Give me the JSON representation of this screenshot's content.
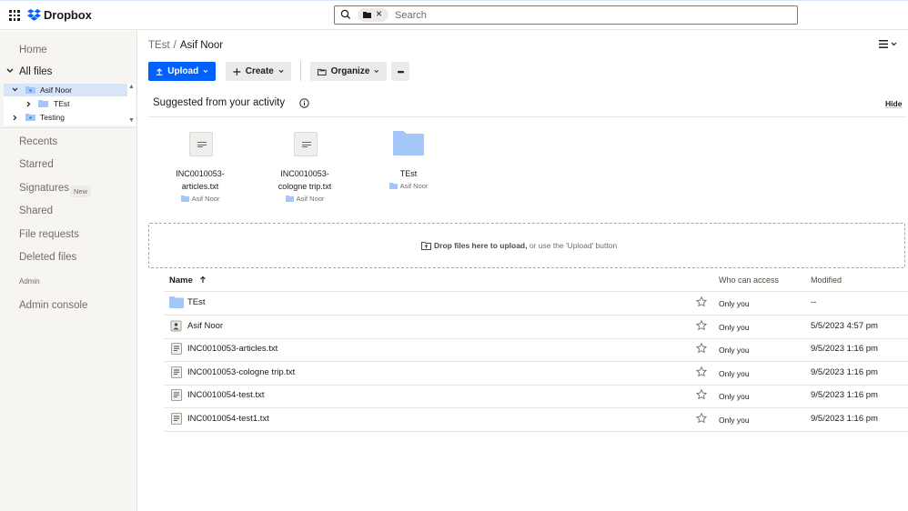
{
  "app": {
    "name": "Dropbox"
  },
  "colors": {
    "accent": "#0061fe",
    "folder": "#a3c8f7",
    "sidebar_bg": "#f7f5f2"
  },
  "search": {
    "placeholder": "Search"
  },
  "sidebar": {
    "home": "Home",
    "all_files": "All files",
    "tree": [
      {
        "label": "Asif Noor",
        "expanded": true,
        "selected": true
      },
      {
        "label": "TEst",
        "expanded": false,
        "selected": false
      },
      {
        "label": "Testing",
        "expanded": false,
        "selected": false
      }
    ],
    "recents": "Recents",
    "starred": "Starred",
    "signatures": "Signatures",
    "signatures_badge": "New",
    "shared": "Shared",
    "file_requests": "File requests",
    "deleted_files": "Deleted files",
    "admin_label": "Admin",
    "admin_console": "Admin console"
  },
  "breadcrumb": {
    "parent": "TEst",
    "separator": "/",
    "current": "Asif Noor"
  },
  "toolbar": {
    "upload": "Upload",
    "create": "Create",
    "organize": "Organize",
    "more": "•••"
  },
  "suggested": {
    "title": "Suggested from your activity",
    "hide": "Hide",
    "items": [
      {
        "name_line1": "INC0010053-",
        "name_line2": "articles.txt",
        "location": "Asif Noor",
        "icon": "text-file-icon"
      },
      {
        "name_line1": "INC0010053-",
        "name_line2": "cologne trip.txt",
        "location": "Asif Noor",
        "icon": "text-file-icon"
      },
      {
        "name_line1": "TEst",
        "name_line2": "",
        "location": "Asif Noor",
        "icon": "folder-icon"
      }
    ]
  },
  "dropzone": {
    "bold": "Drop files here to upload,",
    "rest": " or use the 'Upload' button"
  },
  "table": {
    "headers": {
      "name": "Name",
      "who": "Who can access",
      "modified": "Modified"
    },
    "rows": [
      {
        "name": "TEst",
        "who": "Only you",
        "modified": "--",
        "icon": "folder-icon"
      },
      {
        "name": "Asif Noor",
        "who": "Only you",
        "modified": "5/5/2023 4:57 pm",
        "icon": "team-folder-icon"
      },
      {
        "name": "INC0010053-articles.txt",
        "who": "Only you",
        "modified": "9/5/2023 1:16 pm",
        "icon": "text-file-icon"
      },
      {
        "name": "INC0010053-cologne trip.txt",
        "who": "Only you",
        "modified": "9/5/2023 1:16 pm",
        "icon": "text-file-icon"
      },
      {
        "name": "INC0010054-test.txt",
        "who": "Only you",
        "modified": "9/5/2023 1:16 pm",
        "icon": "text-file-icon"
      },
      {
        "name": "INC0010054-test1.txt",
        "who": "Only you",
        "modified": "9/5/2023 1:16 pm",
        "icon": "text-file-icon"
      }
    ]
  }
}
